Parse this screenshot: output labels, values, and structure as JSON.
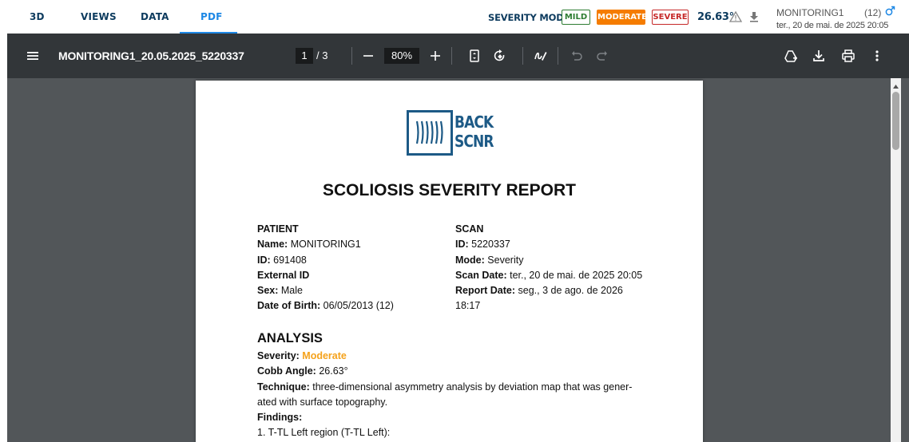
{
  "top_tabs": [
    {
      "label": "3D"
    },
    {
      "label": "VIEWS"
    },
    {
      "label": "DATA"
    },
    {
      "label": "PDF",
      "active": true
    }
  ],
  "severity_mode": {
    "label": "SEVERITY MODE",
    "options": [
      "MILD",
      "MODERATE",
      "SEVERE"
    ],
    "selected": "MODERATE",
    "colors": {
      "mild": "#2e7d32",
      "moderate": "#f57c00",
      "severe": "#c62828"
    }
  },
  "angle_value": "26.63°",
  "icons": [
    "warning-icon",
    "download-icon",
    "male-icon",
    "menu-icon",
    "zoom-out-icon",
    "zoom-in-icon",
    "fit-page-icon",
    "rotate-icon",
    "annotate-icon",
    "undo-icon",
    "redo-icon",
    "drive-add-icon",
    "download-icon",
    "print-icon",
    "more-icon"
  ],
  "patient_header": {
    "name": "MONITORING1",
    "count": "(12)",
    "date": "ter., 20 de mai. de 2025 20:05"
  },
  "pdf_toolbar": {
    "title": "MONITORING1_20.05.2025_5220337",
    "page_current": "1",
    "page_total": "/ 3",
    "zoom": "80%"
  },
  "report": {
    "logo_line1": "BACK",
    "logo_line2": "SCNR",
    "title": "SCOLIOSIS SEVERITY REPORT",
    "patient": {
      "heading": "PATIENT",
      "name_label": "Name:",
      "name": "MONITORING1",
      "id_label": "ID:",
      "id": "691408",
      "external_id_label": "External ID",
      "sex_label": "Sex:",
      "sex": "Male",
      "dob_label": "Date of Birth:",
      "dob": "06/05/2013 (12)"
    },
    "scan": {
      "heading": "SCAN",
      "id_label": "ID:",
      "id": "5220337",
      "mode_label": "Mode:",
      "mode": "Severity",
      "scan_date_label": "Scan Date:",
      "scan_date": "ter., 20 de mai. de 2025 20:05",
      "report_date_label": "Report Date:",
      "report_date": "seg., 3 de ago. de 2026",
      "report_time": "18:17"
    },
    "analysis": {
      "heading": "ANALYSIS",
      "severity_label": "Severity:",
      "severity": "Moderate",
      "cobb_label": "Cobb Angle:",
      "cobb": "26.63°",
      "technique_label": "Technique:",
      "technique": "three-dimensional asymmetry analysis by deviation map that was gener-",
      "technique_line2": "ated with surface topography.",
      "findings_label": "Findings:",
      "finding_1": "1. T-TL Left region (T-TL Left):"
    }
  }
}
